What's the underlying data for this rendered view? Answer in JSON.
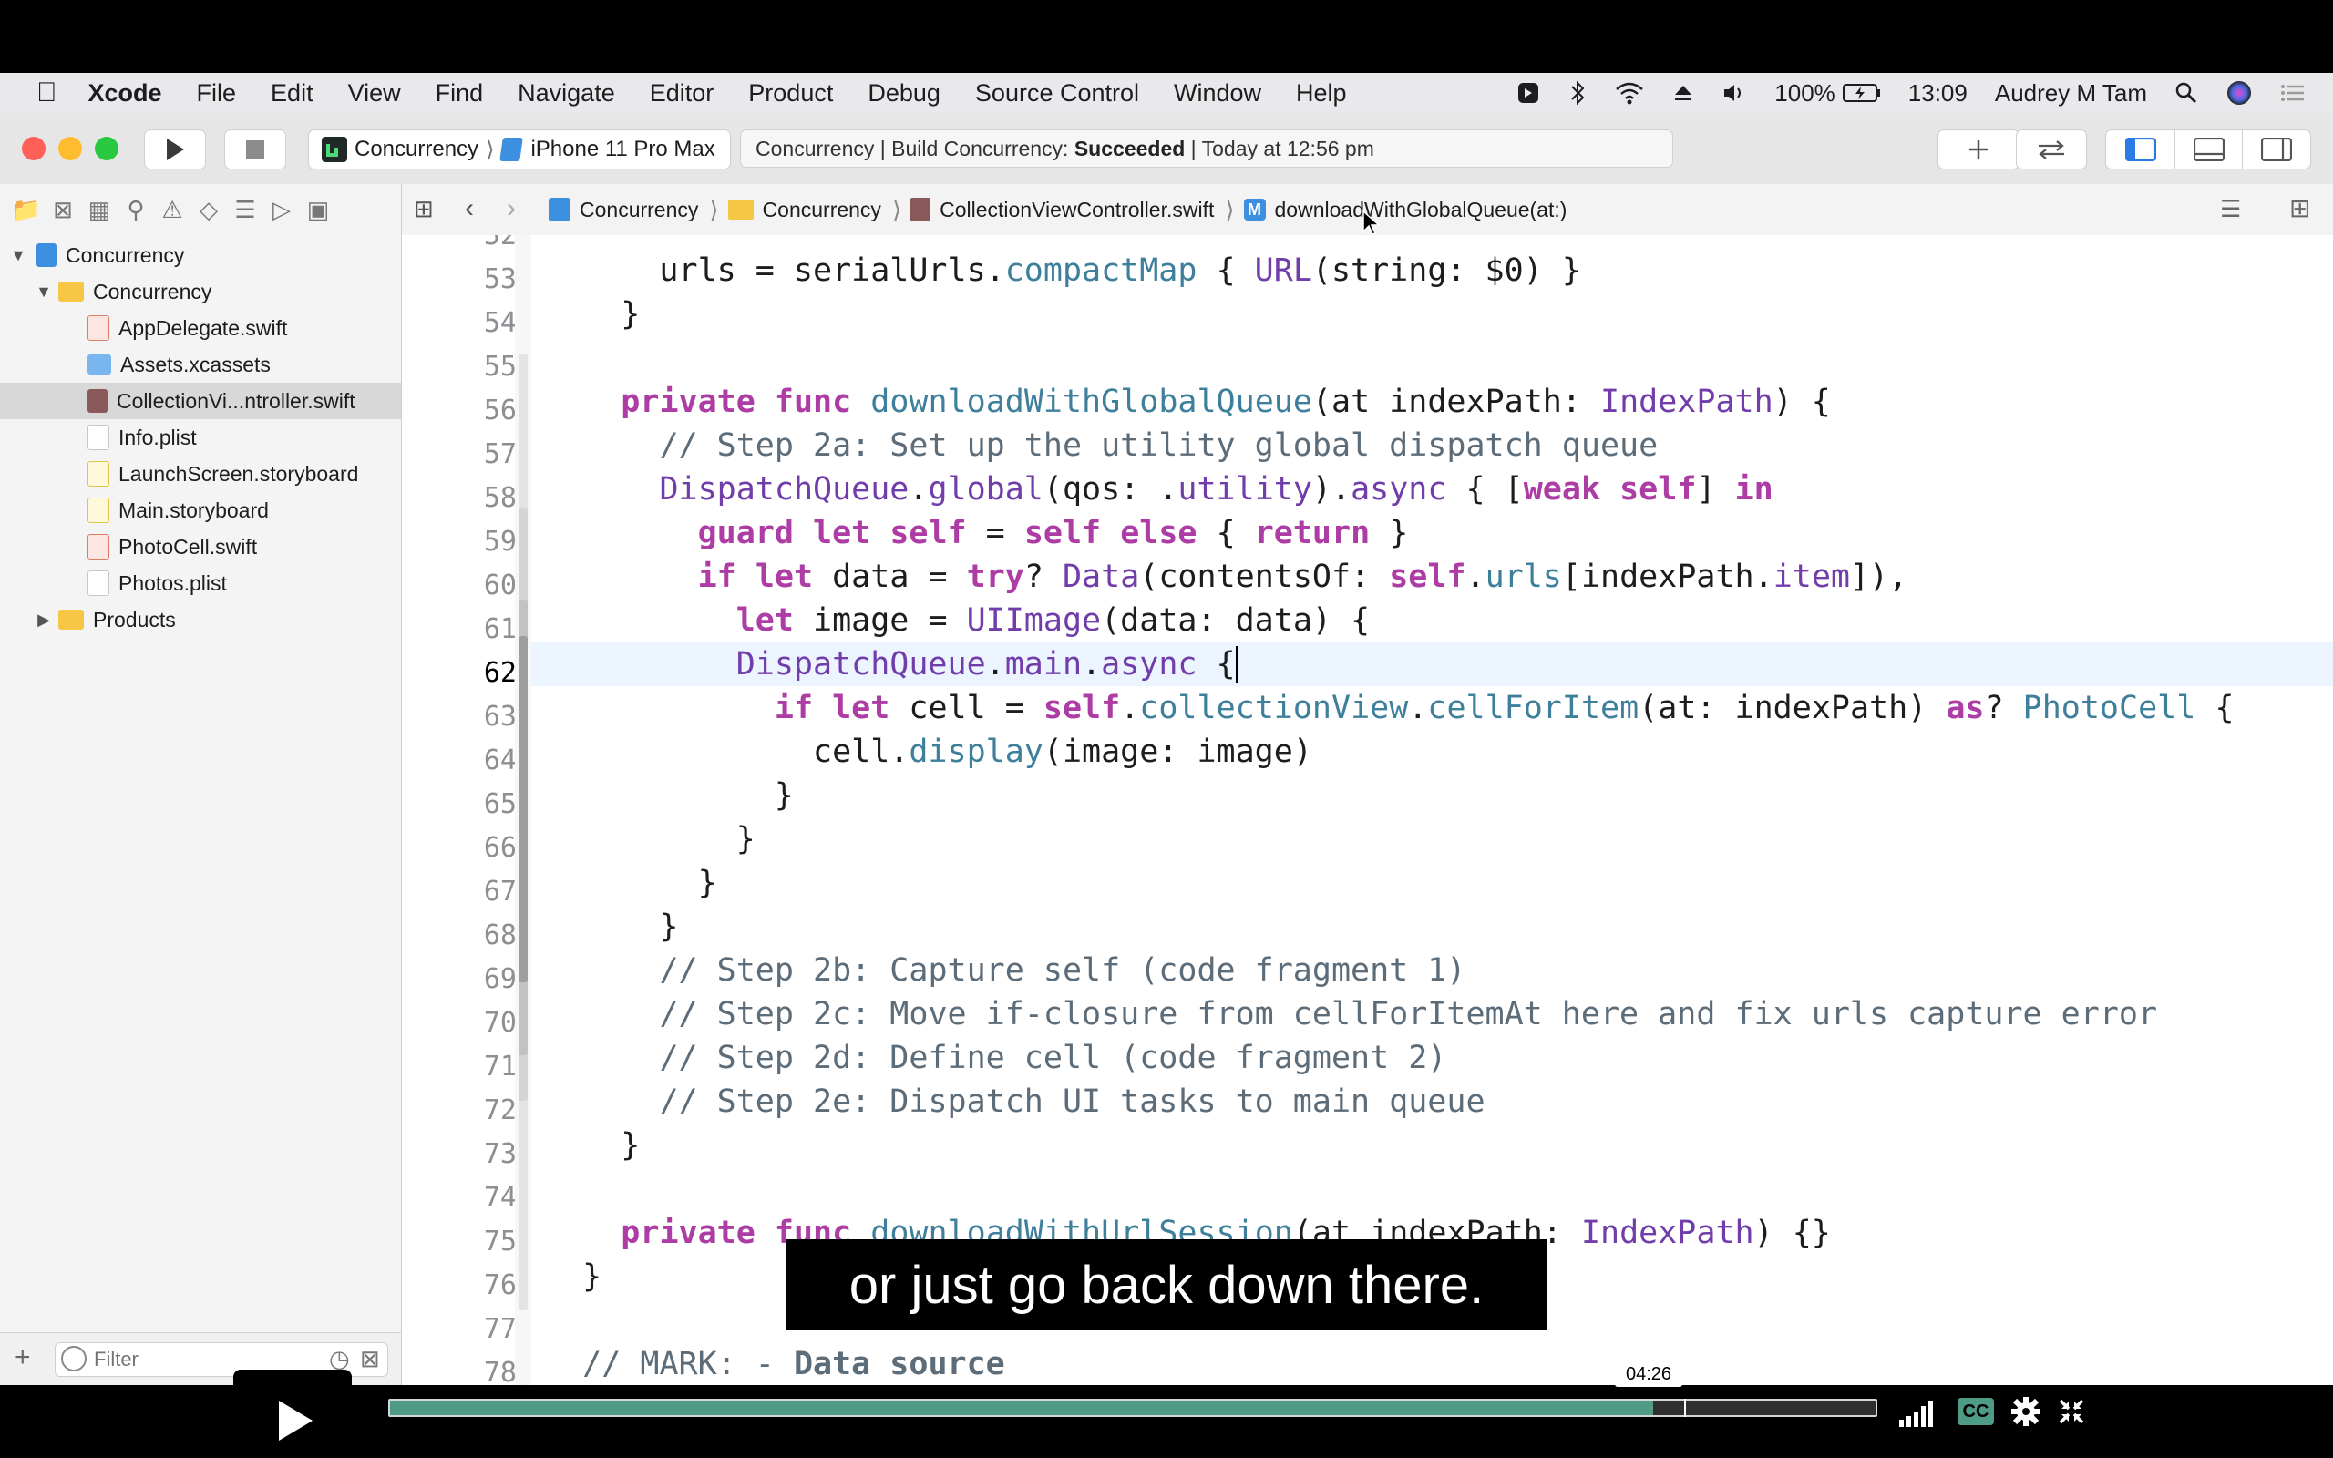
{
  "menubar": {
    "app_name": "Xcode",
    "items": [
      "File",
      "Edit",
      "View",
      "Find",
      "Navigate",
      "Editor",
      "Product",
      "Debug",
      "Source Control",
      "Window",
      "Help"
    ],
    "battery": "100%",
    "time": "13:09",
    "user": "Audrey M Tam"
  },
  "toolbar": {
    "scheme": "Concurrency",
    "device": "iPhone 11 Pro Max",
    "activity_prefix": "Concurrency | Build Concurrency: ",
    "activity_status": "Succeeded",
    "activity_suffix": " | Today at 12:56 pm"
  },
  "breadcrumb": {
    "project": "Concurrency",
    "group": "Concurrency",
    "file": "CollectionViewController.swift",
    "method_badge": "M",
    "method": "downloadWithGlobalQueue(at:)"
  },
  "navigator": {
    "items": [
      {
        "label": "Concurrency",
        "depth": 0
      },
      {
        "label": "Concurrency",
        "depth": 1
      },
      {
        "label": "AppDelegate.swift",
        "depth": 2
      },
      {
        "label": "Assets.xcassets",
        "depth": 2
      },
      {
        "label": "CollectionVi...ntroller.swift",
        "depth": 2
      },
      {
        "label": "Info.plist",
        "depth": 2
      },
      {
        "label": "LaunchScreen.storyboard",
        "depth": 2
      },
      {
        "label": "Main.storyboard",
        "depth": 2
      },
      {
        "label": "PhotoCell.swift",
        "depth": 2
      },
      {
        "label": "Photos.plist",
        "depth": 2
      },
      {
        "label": "Products",
        "depth": 1
      }
    ],
    "filter_placeholder": "Filter"
  },
  "editor": {
    "current_line": "62",
    "line_numbers": [
      "53",
      "54",
      "55",
      "56",
      "57",
      "58",
      "59",
      "60",
      "61",
      "62",
      "63",
      "64",
      "65",
      "66",
      "67",
      "68",
      "69",
      "70",
      "71",
      "72",
      "73",
      "74",
      "75",
      "76",
      "77",
      "78"
    ]
  },
  "caption": "or just go back down there.",
  "player": {
    "timestamp": "04:26",
    "progress": 0.85,
    "cc_label": "CC"
  },
  "colors": {
    "keyword": "#ad3da4",
    "type": "#703daa",
    "function": "#3e7f9b",
    "comment": "#5d6c79",
    "progress_fill": "#4e9c86"
  }
}
